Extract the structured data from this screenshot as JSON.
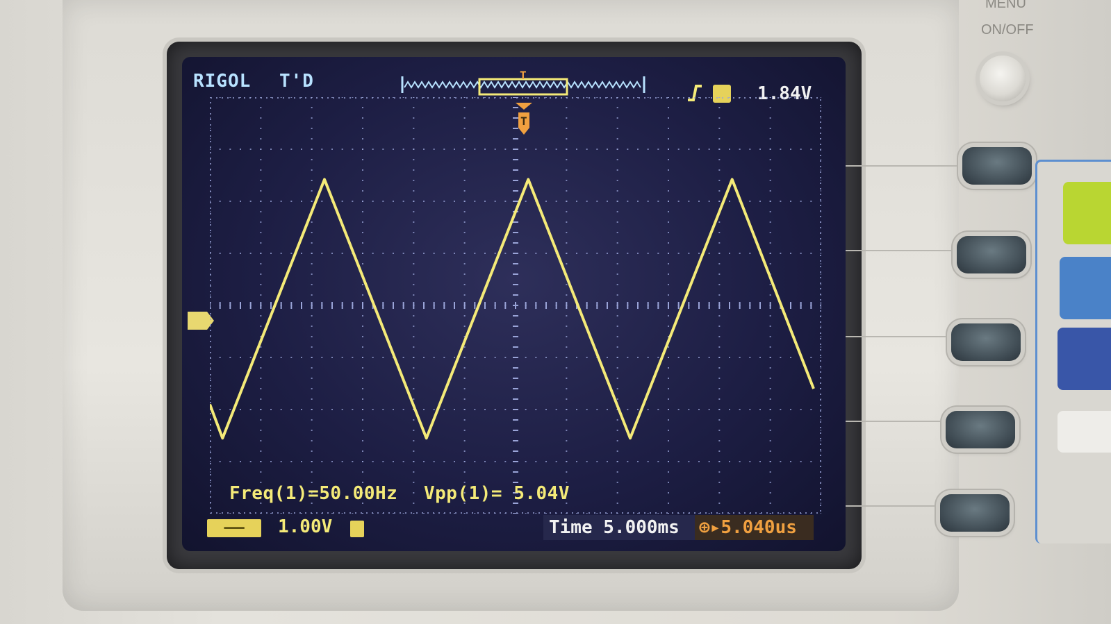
{
  "colors": {
    "screen_bg": "#1d1e44",
    "grid": "#9aa4d8",
    "trace": "#f4ea78",
    "header_text": "#b8e2ff",
    "trigger_marker": "#f0a040"
  },
  "header": {
    "brand": "RIGOL",
    "run_state": "T'D",
    "trigger_level": "1.84V"
  },
  "measurements": {
    "freq": "Freq(1)=50.00Hz",
    "vpp": "Vpp(1)= 5.04V"
  },
  "status": {
    "channel_scale": "1.00V",
    "timebase": "Time 5.000ms",
    "delay": "5.040us"
  },
  "panel": {
    "menu_label": "MENU",
    "onoff_label": "ON/OFF"
  },
  "waveform": {
    "type": "triangle",
    "frequency_hz": 50,
    "vpp_v": 5.04,
    "volts_per_div": 1.0,
    "time_per_div_ms": 5.0,
    "vertices": [
      {
        "x_div": 0.0,
        "y_div": -1.9
      },
      {
        "x_div": 0.25,
        "y_div": -2.55
      },
      {
        "x_div": 2.25,
        "y_div": 2.42
      },
      {
        "x_div": 4.25,
        "y_div": -2.55
      },
      {
        "x_div": 6.25,
        "y_div": 2.42
      },
      {
        "x_div": 8.25,
        "y_div": -2.55
      },
      {
        "x_div": 10.25,
        "y_div": 2.42
      },
      {
        "x_div": 11.85,
        "y_div": -1.6
      }
    ]
  }
}
